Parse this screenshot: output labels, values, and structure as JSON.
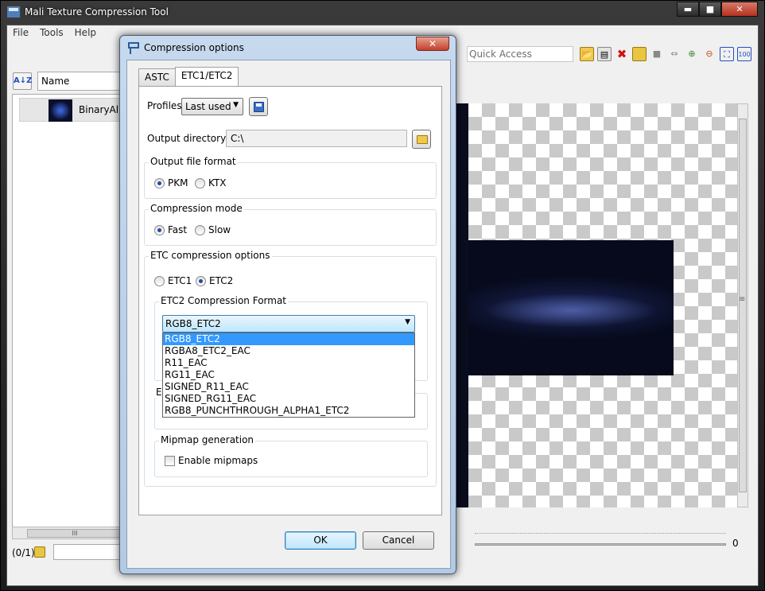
{
  "app": {
    "title": "Mali Texture Compression Tool",
    "menu": [
      "File",
      "Tools",
      "Help"
    ],
    "caption_buttons": {
      "minimize": "▬",
      "maximize": "■",
      "close": "✕"
    }
  },
  "file_panel": {
    "column_header": "Name",
    "files": [
      {
        "name": "BinaryAlpha"
      }
    ],
    "scroll_glyph": "III",
    "status_count": "(0/1)"
  },
  "toolbar": {
    "quick_access_placeholder": "Quick Access",
    "icons": [
      "open-folder-icon",
      "save-icon",
      "delete-icon",
      "compress-icon",
      "stop-icon",
      "compare-icon",
      "zoom-in-icon",
      "zoom-out-icon",
      "fit-icon",
      "actual-size-icon"
    ]
  },
  "preview": {
    "zoom_value": "0",
    "vscroll_grip": "≡"
  },
  "dialog": {
    "title": "Compression options",
    "close_glyph": "✕",
    "tabs": [
      {
        "label": "ASTC"
      },
      {
        "label": "ETC1/ETC2"
      }
    ],
    "active_tab": "ETC1/ETC2",
    "profiles_label": "Profiles",
    "profiles_value": "Last used",
    "output_directory_label": "Output directory:",
    "output_directory_value": "C:\\",
    "output_file_format": {
      "title": "Output file format",
      "options": [
        "PKM",
        "KTX"
      ],
      "selected": "PKM"
    },
    "compression_mode": {
      "title": "Compression mode",
      "options": [
        "Fast",
        "Slow"
      ],
      "selected": "Fast"
    },
    "etc_options": {
      "title": "ETC compression options",
      "options": [
        "ETC1",
        "ETC2"
      ],
      "selected": "ETC2",
      "etc2_format": {
        "title": "ETC2 Compression Format",
        "selected": "RGB8_ETC2",
        "list": [
          "RGB8_ETC2",
          "RGBA8_ETC2_EAC",
          "R11_EAC",
          "RG11_EAC",
          "SIGNED_R11_EAC",
          "SIGNED_RG11_EAC",
          "RGB8_PUNCHTHROUGH_ALPHA1_ETC2"
        ]
      },
      "hidden_group_letter": "E"
    },
    "mipmap": {
      "title": "Mipmap generation",
      "checkbox_label": "Enable mipmaps",
      "checked": false
    },
    "ok_label": "OK",
    "cancel_label": "Cancel"
  }
}
